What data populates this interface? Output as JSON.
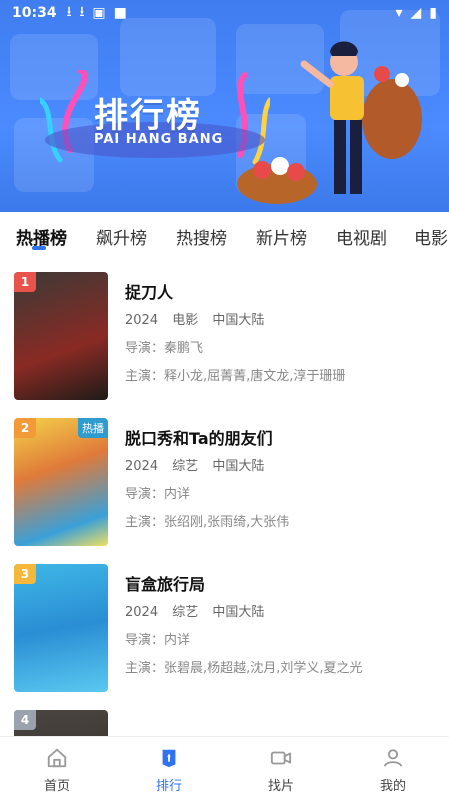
{
  "status_bar": {
    "time": "10:34"
  },
  "banner": {
    "title": "排行榜",
    "subtitle": "PAI HANG BANG"
  },
  "tabs": [
    {
      "label": "热播榜",
      "active": true
    },
    {
      "label": "飙升榜"
    },
    {
      "label": "热搜榜"
    },
    {
      "label": "新片榜"
    },
    {
      "label": "电视剧"
    },
    {
      "label": "电影"
    }
  ],
  "list": [
    {
      "rank": "1",
      "title": "捉刀人",
      "year": "2024",
      "type": "电影",
      "region": "中国大陆",
      "director": "导演：秦鹏飞",
      "cast": "主演：释小龙,屈菁菁,唐文龙,淳于珊珊",
      "rank_color": "#e8544b"
    },
    {
      "rank": "2",
      "title": "脱口秀和Ta的朋友们",
      "year": "2024",
      "type": "综艺",
      "region": "中国大陆",
      "director": "导演：内详",
      "cast": "主演：张绍刚,张雨绮,大张伟",
      "rank_color": "#f29a38",
      "hot": "热播"
    },
    {
      "rank": "3",
      "title": "盲盒旅行局",
      "year": "2024",
      "type": "综艺",
      "region": "中国大陆",
      "director": "导演：内详",
      "cast": "主演：张碧晨,杨超越,沈月,刘学义,夏之光",
      "rank_color": "#f5b83a"
    },
    {
      "rank": "4",
      "title": "",
      "rank_color": "#9aa3ad"
    }
  ],
  "navbar": [
    {
      "label": "首页",
      "icon": "home-icon"
    },
    {
      "label": "排行",
      "icon": "ranking-icon",
      "active": true
    },
    {
      "label": "找片",
      "icon": "video-search-icon"
    },
    {
      "label": "我的",
      "icon": "profile-icon"
    }
  ],
  "colors": {
    "accent": "#2f73f0",
    "banner": "#4b8bff"
  }
}
